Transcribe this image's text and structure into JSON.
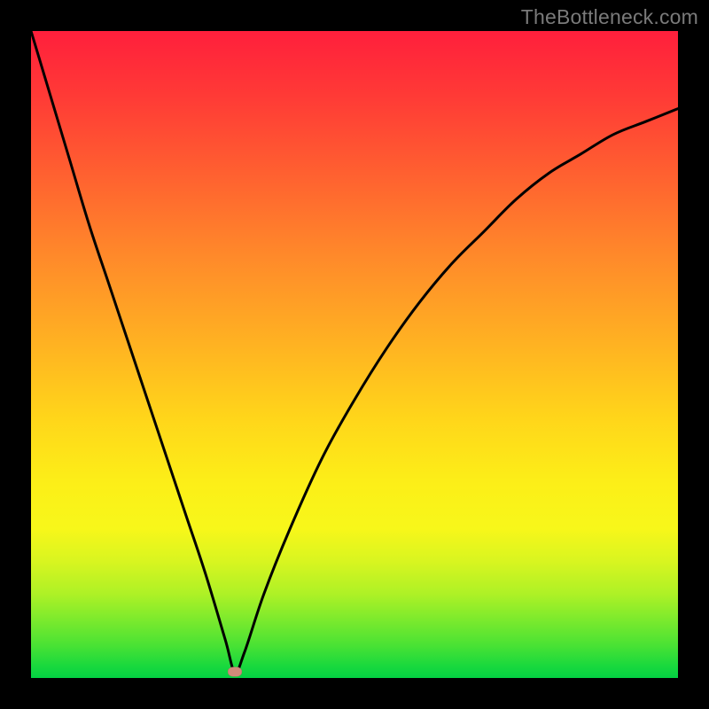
{
  "watermark": "TheBottleneck.com",
  "colors": {
    "frame": "#000000",
    "gradient_top": "#ff1f3c",
    "gradient_bottom": "#04d143",
    "curve": "#000000",
    "marker": "#d18a7a"
  },
  "chart_data": {
    "type": "line",
    "title": "",
    "xlabel": "",
    "ylabel": "",
    "xlim": [
      0,
      100
    ],
    "ylim": [
      0,
      100
    ],
    "grid": false,
    "legend": false,
    "annotations": [],
    "series": [
      {
        "name": "bottleneck-curve",
        "x": [
          0,
          3,
          6,
          9,
          12,
          15,
          18,
          21,
          24,
          27,
          30,
          31.5,
          33,
          36,
          40,
          45,
          50,
          55,
          60,
          65,
          70,
          75,
          80,
          85,
          90,
          95,
          100
        ],
        "values": [
          100,
          90,
          80,
          70,
          61,
          52,
          43,
          34,
          25,
          16,
          6,
          1,
          4,
          13,
          23,
          34,
          43,
          51,
          58,
          64,
          69,
          74,
          78,
          81,
          84,
          86,
          88
        ]
      }
    ],
    "marker": {
      "x": 31.5,
      "y": 1
    }
  }
}
